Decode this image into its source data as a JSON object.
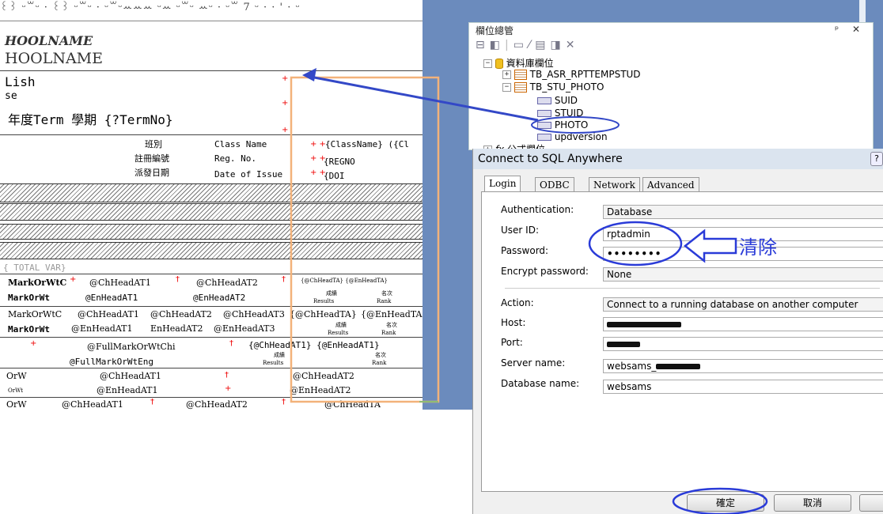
{
  "report": {
    "ruler": "꒰꒱ ᵕ꒳ᵕ · ꒰꒱ ᵕ꒳ᵕ · ᵕ꒳ᵕꕀꕀꕀ ᵕꕀ ᵕ꒳ᵕ ꕀᵕ · ᵕ꒳ 7 ᵕ · · ' · ᵕ",
    "school1": "HOOLNAME",
    "school2": "HOOLNAME",
    "lish": "Lish",
    "se": "se",
    "term_line": "年度Term 學期 {?TermNo}",
    "class_zh": "班別",
    "class_en": "Class Name",
    "class_field": "{ClassName} ({Cl",
    "reg_zh": "註冊編號",
    "reg_en": "Reg. No.",
    "reg_field": "{REGNO",
    "issue_zh": "派發日期",
    "issue_en": "Date of Issue",
    "issue_field": "{DOI",
    "total_var": "{ TOTAL  VAR}",
    "r1_a": "MarkOrWtC",
    "r1_b": "@ChHeadAT1",
    "r1_c": "@ChHeadAT2",
    "r1_d": "{@ChHeadTA} {@EnHeadTA}",
    "r2_a": "MarkOrWt",
    "r2_b": "@EnHeadAT1",
    "r2_c": "@EnHeadAT2",
    "r2_d1": "成績",
    "r2_d2": "名次",
    "r2_e1": "Results",
    "r2_e2": "Rank",
    "r3_a": "MarkOrWtC",
    "r3_b": "@ChHeadAT1",
    "r3_c": "@ChHeadAT2",
    "r3_d": "@ChHeadAT3",
    "r3_e": "{@ChHeadTA}",
    "r3_f": "{@EnHeadTA",
    "r4_a": "MarkOrWt",
    "r4_b": "@EnHeadAT1",
    "r4_c": "EnHeadAT2",
    "r4_d": "@EnHeadAT3",
    "r4_e1": "成績",
    "r4_e2": "名次",
    "r4_f1": "Results",
    "r4_f2": "Rank",
    "r5_a": "@FullMarkOrWtChi",
    "r5_b": "{@ChHeadAT1} {@EnHeadAT1}",
    "r6_a": "@FullMarkOrWtEng",
    "r6_b1": "成績",
    "r6_b2": "名次",
    "r6_c1": "Results",
    "r6_c2": "Rank",
    "r7_a": "OrW",
    "r7_b": "@ChHeadAT1",
    "r7_c": "@ChHeadAT2",
    "r8_a": "OrWt",
    "r8_b": "@EnHeadAT1",
    "r8_c": "@EnHeadAT2",
    "r9_a": "OrW",
    "r9_b": "@ChHeadAT1",
    "r9_c": "@ChHeadAT2",
    "r9_d": "@ChHeadTA"
  },
  "explorer": {
    "title": "欄位總管",
    "pin": "ᵖ",
    "close": "✕",
    "tree": [
      {
        "label": "資料庫欄位",
        "expander": "−"
      },
      {
        "label": "TB_ASR_RPTTEMPSTUD",
        "expander": "+"
      },
      {
        "label": "TB_STU_PHOTO",
        "expander": "−"
      },
      {
        "label": "SUID"
      },
      {
        "label": "STUID"
      },
      {
        "label": "PHOTO"
      },
      {
        "label": "updversion"
      },
      {
        "label": "公式欄位",
        "expander": "+"
      }
    ]
  },
  "dialog": {
    "title": "Connect to SQL Anywhere",
    "help": "?",
    "tabs": [
      "Login",
      "ODBC",
      "Network",
      "Advanced"
    ],
    "authentication_label": "Authentication:",
    "authentication_value": "Database",
    "userid_label": "User ID:",
    "userid_value": "rptadmin",
    "password_label": "Password:",
    "password_value": "••••••••",
    "encrypt_label": "Encrypt password:",
    "encrypt_value": "None",
    "action_label": "Action:",
    "action_value": "Connect to a running database on another computer",
    "host_label": "Host:",
    "port_label": "Port:",
    "server_label": "Server name:",
    "server_value": "websams_",
    "dbname_label": "Database name:",
    "dbname_value": "websams",
    "ok_button": "確定",
    "cancel_button": "取消"
  },
  "annotation": {
    "clear_text": "清除"
  },
  "colors": {
    "annotation_blue": "#2a3bd8",
    "arrow_blue": "#3348c7",
    "highlight_orange": "#f3b27a",
    "background_blue": "#6b8bbd"
  }
}
